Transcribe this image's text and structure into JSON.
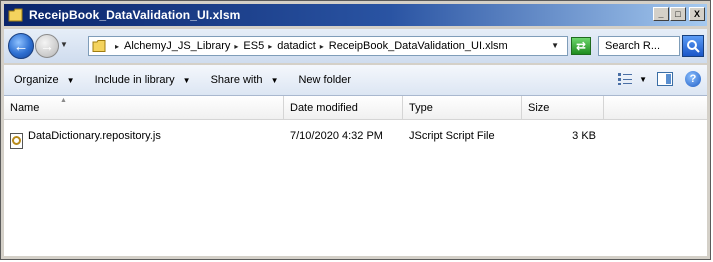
{
  "window": {
    "title": "ReceipBook_DataValidation_UI.xlsm"
  },
  "caption_buttons": {
    "minimize": "_",
    "maximize": "□",
    "close": "X"
  },
  "address": {
    "crumbs": [
      "AlchemyJ_JS_Library",
      "ES5",
      "datadict",
      "ReceipBook_DataValidation_UI.xlsm"
    ],
    "separator": "▸"
  },
  "search": {
    "placeholder": "Search R..."
  },
  "toolbar": {
    "organize": "Organize",
    "include_in_library": "Include in library",
    "share_with": "Share with",
    "new_folder": "New folder"
  },
  "columns": {
    "name": "Name",
    "date_modified": "Date modified",
    "type": "Type",
    "size": "Size"
  },
  "files": [
    {
      "name": "DataDictionary.repository.js",
      "date_modified": "7/10/2020 4:32 PM",
      "type": "JScript Script File",
      "size": "3 KB"
    }
  ]
}
